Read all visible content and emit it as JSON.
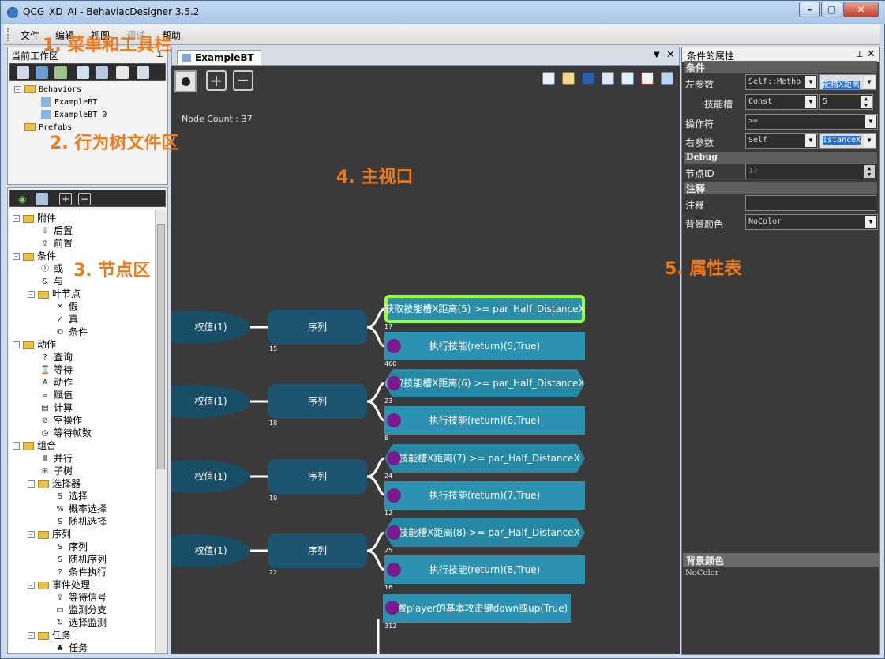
{
  "window": {
    "title": "QCG_XD_AI - BehaviacDesigner 3.5.2"
  },
  "menu": [
    "文件",
    "编辑",
    "视图",
    "调试",
    "帮助"
  ],
  "annotations": {
    "menu": "1. 菜单和工具栏",
    "files": "2. 行为树文件区",
    "nodes": "3. 节点区",
    "main": "4. 主视口",
    "props": "5. 属性表"
  },
  "workspace": {
    "title": "当前工作区",
    "tree": [
      "Behaviors",
      "ExampleBT",
      "ExampleBT_0",
      "Prefabs"
    ]
  },
  "nodes_tree": [
    {
      "label": "附件",
      "level": 0,
      "folder": true
    },
    {
      "label": "后置",
      "level": 1,
      "icon": "⇩"
    },
    {
      "label": "前置",
      "level": 1,
      "icon": "⇧"
    },
    {
      "label": "条件",
      "level": 0,
      "folder": true
    },
    {
      "label": "或",
      "level": 1,
      "icon": "Ⓘ"
    },
    {
      "label": "与",
      "level": 1,
      "icon": "&"
    },
    {
      "label": "叶节点",
      "level": 1,
      "folder": true
    },
    {
      "label": "假",
      "level": 2,
      "icon": "✕"
    },
    {
      "label": "真",
      "level": 2,
      "icon": "✓"
    },
    {
      "label": "条件",
      "level": 2,
      "icon": "©"
    },
    {
      "label": "动作",
      "level": 0,
      "folder": true
    },
    {
      "label": "查询",
      "level": 1,
      "icon": "?"
    },
    {
      "label": "等待",
      "level": 1,
      "icon": "⌛"
    },
    {
      "label": "动作",
      "level": 1,
      "icon": "A"
    },
    {
      "label": "赋值",
      "level": 1,
      "icon": "="
    },
    {
      "label": "计算",
      "level": 1,
      "icon": "▤"
    },
    {
      "label": "空操作",
      "level": 1,
      "icon": "⊘"
    },
    {
      "label": "等待帧数",
      "level": 1,
      "icon": "◷"
    },
    {
      "label": "组合",
      "level": 0,
      "folder": true
    },
    {
      "label": "并行",
      "level": 1,
      "icon": "Ⅲ"
    },
    {
      "label": "子树",
      "level": 1,
      "icon": "⊞"
    },
    {
      "label": "选择器",
      "level": 1,
      "folder": true
    },
    {
      "label": "选择",
      "level": 2,
      "icon": "S"
    },
    {
      "label": "概率选择",
      "level": 2,
      "icon": "%"
    },
    {
      "label": "随机选择",
      "level": 2,
      "icon": "S"
    },
    {
      "label": "序列",
      "level": 1,
      "folder": true
    },
    {
      "label": "序列",
      "level": 2,
      "icon": "S"
    },
    {
      "label": "随机序列",
      "level": 2,
      "icon": "S"
    },
    {
      "label": "条件执行",
      "level": 2,
      "icon": "?"
    },
    {
      "label": "事件处理",
      "level": 1,
      "folder": true
    },
    {
      "label": "等待信号",
      "level": 2,
      "icon": "⇪"
    },
    {
      "label": "监测分支",
      "level": 2,
      "icon": "▭"
    },
    {
      "label": "选择监测",
      "level": 2,
      "icon": "↻"
    },
    {
      "label": "任务",
      "level": 1,
      "folder": true
    },
    {
      "label": "任务",
      "level": 2,
      "icon": "♣"
    }
  ],
  "main": {
    "tab": "ExampleBT",
    "node_count": "Node Count : 37",
    "rows": [
      {
        "weight": "权值(1)",
        "seq": "序列",
        "seq_id": "15",
        "cond": "获取技能槽X距离(5)  >= par_Half_DistanceX",
        "cond_id": "17",
        "act": "执行技能(return)(5,True)",
        "act_id": "460"
      },
      {
        "weight": "权值(1)",
        "seq": "序列",
        "seq_id": "18",
        "cond": "获取技能槽X距离(6)  >= par_Half_DistanceX",
        "cond_id": "23",
        "act": "执行技能(return)(6,True)",
        "act_id": "8"
      },
      {
        "weight": "权值(1)",
        "seq": "序列",
        "seq_id": "19",
        "cond": "取技能槽X距离(7)  >= par_Half_DistanceX",
        "cond_id": "24",
        "act": "执行技能(return)(7,True)",
        "act_id": "12"
      },
      {
        "weight": "权值(1)",
        "seq": "序列",
        "seq_id": "22",
        "cond": "取技能槽X距离(8)  >= par_Half_DistanceX",
        "cond_id": "25",
        "act": "执行技能(return)(8,True)",
        "act_id": "16"
      }
    ],
    "last_act": "置player的基本攻击键down或up(True)",
    "last_act_id": "312"
  },
  "properties": {
    "title": "条件的属性",
    "section_condition": "条件",
    "left_param_label": "左参数",
    "left_param_value": "Self::Metho",
    "left_param_method": "能槽X距离",
    "skill_slot_label": "技能槽",
    "skill_slot_type": "Const",
    "skill_slot_value": "5",
    "operator_label": "操作符",
    "operator_value": ">=",
    "right_param_label": "右参数",
    "right_param_value": "Self",
    "right_param_prop": "istanceX",
    "section_debug": "Debug",
    "node_id_label": "节点ID",
    "node_id_value": "17",
    "section_comment": "注释",
    "comment_label": "注释",
    "bg_color_label": "背景颜色",
    "bg_color_value": "NoColor",
    "help_title": "背景颜色",
    "help_text": "NoColor"
  }
}
